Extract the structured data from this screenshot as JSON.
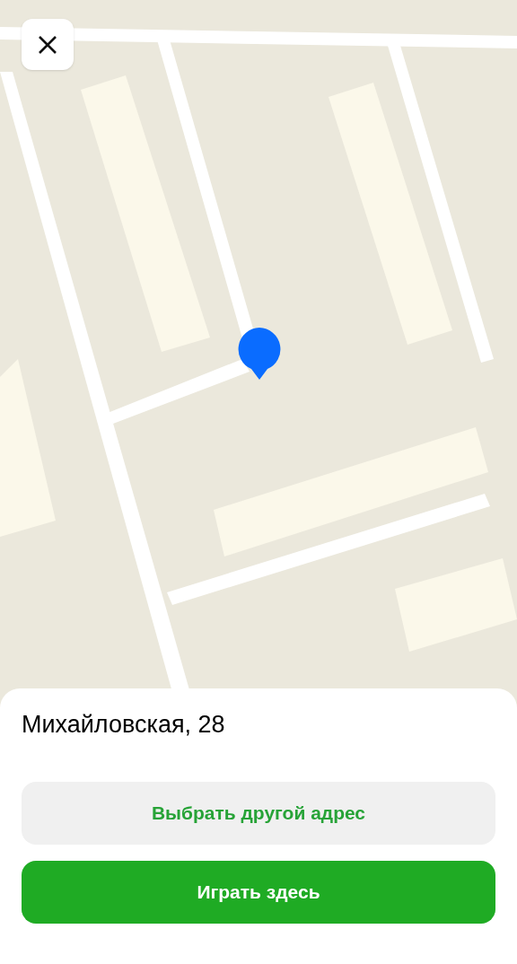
{
  "address": "Михайловская, 28",
  "buttons": [
    {
      "label": "Выбрать другой адрес",
      "kind": "secondary"
    },
    {
      "label": "Играть здесь",
      "kind": "primary"
    }
  ]
}
